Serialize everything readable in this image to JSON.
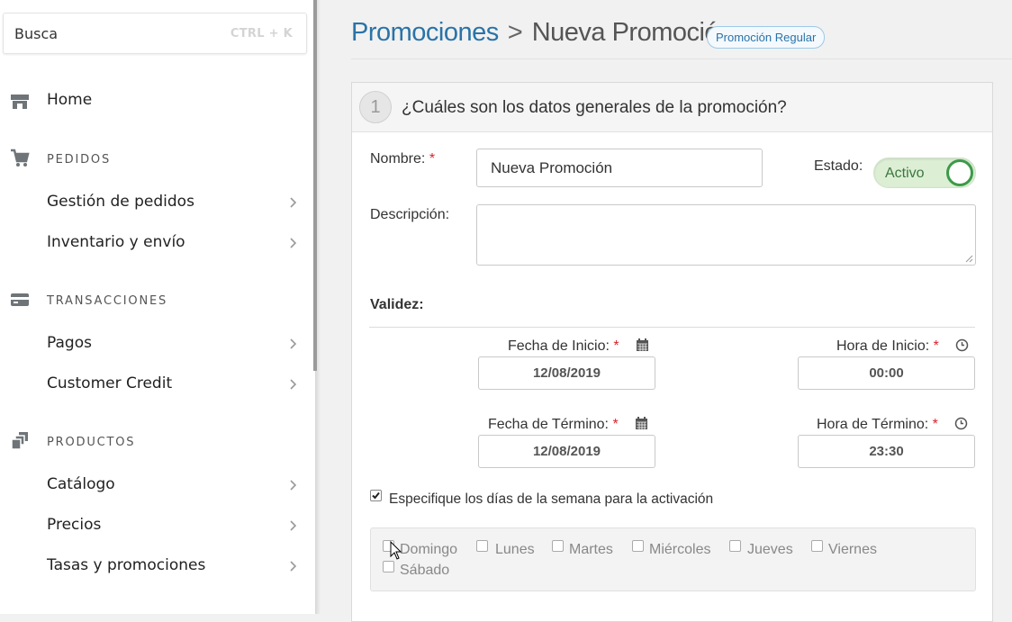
{
  "search": {
    "placeholder": "Busca",
    "shortcut": "CTRL + K"
  },
  "sidebar": {
    "home": "Home",
    "sections": [
      {
        "label": "PEDIDOS",
        "icon": "cart-icon",
        "items": [
          "Gestión de pedidos",
          "Inventario y envío"
        ]
      },
      {
        "label": "TRANSACCIONES",
        "icon": "credit-card-icon",
        "items": [
          "Pagos",
          "Customer Credit"
        ]
      },
      {
        "label": "PRODUCTOS",
        "icon": "layers-icon",
        "items": [
          "Catálogo",
          "Precios",
          "Tasas y promociones"
        ]
      }
    ]
  },
  "breadcrumb": {
    "parent": "Promociones",
    "separator": ">",
    "current": "Nueva Promoción",
    "badge": "Promoción Regular"
  },
  "section1": {
    "number": "1",
    "title": "¿Cuáles son los datos generales de la promoción?",
    "name_label": "Nombre:",
    "name_value": "Nueva Promoción",
    "state_label": "Estado:",
    "state_value": "Activo",
    "desc_label": "Descripción:",
    "validity_label": "Validez:",
    "start_date_label": "Fecha de Inicio:",
    "start_date": "12/08/2019",
    "start_time_label": "Hora de Inicio:",
    "start_time": "00:00",
    "end_date_label": "Fecha de Término:",
    "end_date": "12/08/2019",
    "end_time_label": "Hora de Término:",
    "end_time": "23:30",
    "weekdays_label": "Especifique los días de la semana para la activación",
    "days": [
      "Domingo",
      "Lunes",
      "Martes",
      "Miércoles",
      "Jueves",
      "Viernes",
      "Sábado"
    ]
  },
  "required_mark": "*"
}
